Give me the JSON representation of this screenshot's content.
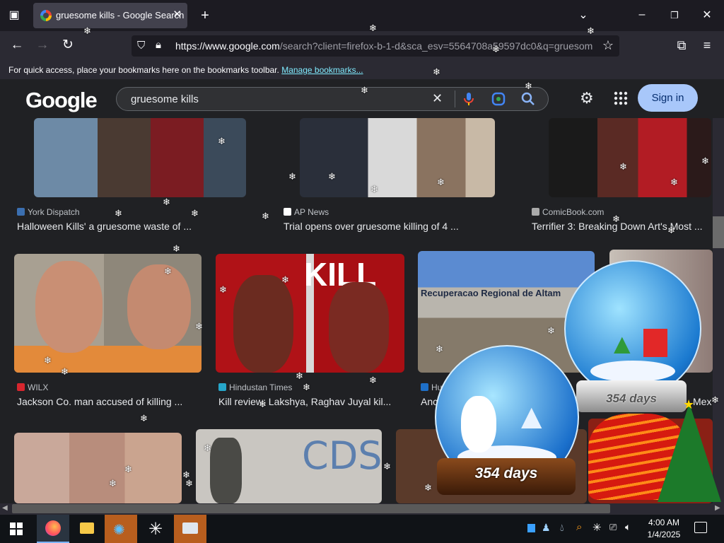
{
  "browser": {
    "tab_title": "gruesome kills - Google Search",
    "url_base": "https://www.google.com",
    "url_rest": "/search?client=firefox-b-1-d&sca_esv=5564708a59597dc0&q=gruesome",
    "bookmarks_message": "For quick access, place your bookmarks here on the bookmarks toolbar.",
    "bookmarks_link": "Manage bookmarks..."
  },
  "google": {
    "logo": "Google",
    "query": "gruesome kills",
    "signin_label": "Sign in"
  },
  "results": {
    "row1": [
      {
        "source": "York Dispatch",
        "caption": "Halloween Kills' a gruesome waste of ..."
      },
      {
        "source": "AP News",
        "caption": "Trial opens over gruesome killing of 4 ..."
      },
      {
        "source": "ComicBook.com",
        "caption": "Terrifier 3: Breaking Down Art's Most ..."
      }
    ],
    "row2": [
      {
        "source": "WILX",
        "caption": "Jackson Co. man accused of killing ..."
      },
      {
        "source": "Hindustan Times",
        "caption": "Kill review: Lakshya, Raghav Juyal kil..."
      },
      {
        "source": "Hu",
        "caption": "Anc"
      },
      {
        "source": "",
        "caption": "Mex"
      }
    ],
    "thumb_texts": {
      "kill_poster": "KILL",
      "prison_sign": "Recuperacao Regional de Altam",
      "graffiti": "CDS"
    }
  },
  "widgets": {
    "globe_small_days": "354 days",
    "globe_large_days": "354 days"
  },
  "taskbar": {
    "time": "4:00 AM",
    "date": "1/4/2025"
  },
  "colors": {
    "signin_bg": "#a8c7fa",
    "link": "#80ebff",
    "tab_active": "#42414d"
  }
}
